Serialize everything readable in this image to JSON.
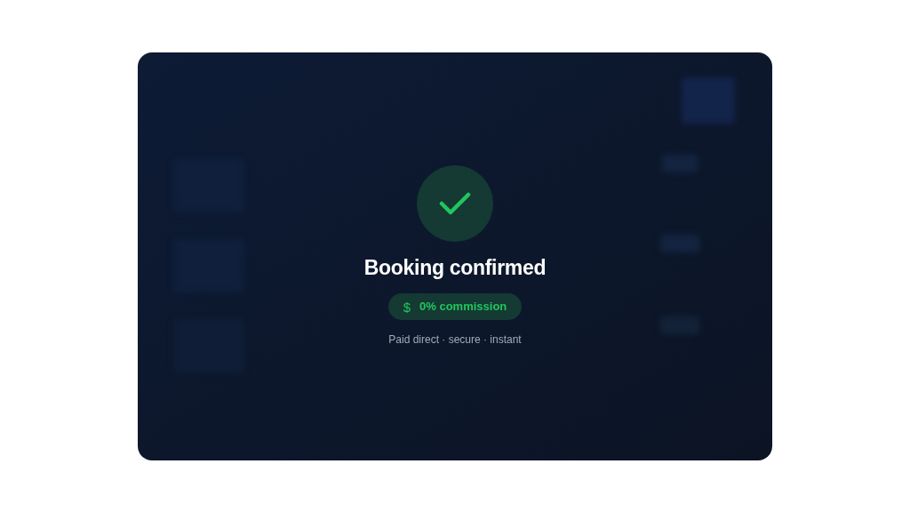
{
  "dialog": {
    "title": "Booking confirmed",
    "badge": {
      "symbol": "$",
      "label": "0% commission"
    },
    "subtitle": "Paid direct · secure · instant"
  }
}
